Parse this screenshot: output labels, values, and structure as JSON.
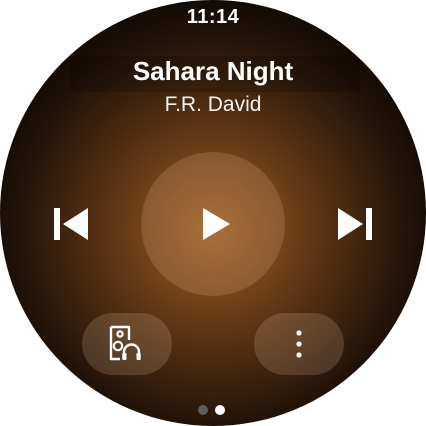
{
  "status": {
    "time": "11:14"
  },
  "track": {
    "title": "Sahara Night",
    "artist": "F.R. David"
  },
  "controls": {
    "previous_icon": "skip-previous-icon",
    "play_icon": "play-icon",
    "next_icon": "skip-next-icon"
  },
  "actions": {
    "output_icon": "speaker-headphones-icon",
    "more_icon": "more-vert-icon"
  },
  "pager": {
    "pages": 2,
    "active_page": 2
  },
  "colors": {
    "accent": "#9a5a22",
    "text": "#ffffff",
    "dot_inactive": "#5c5c5c",
    "dot_active": "#ffffff"
  }
}
